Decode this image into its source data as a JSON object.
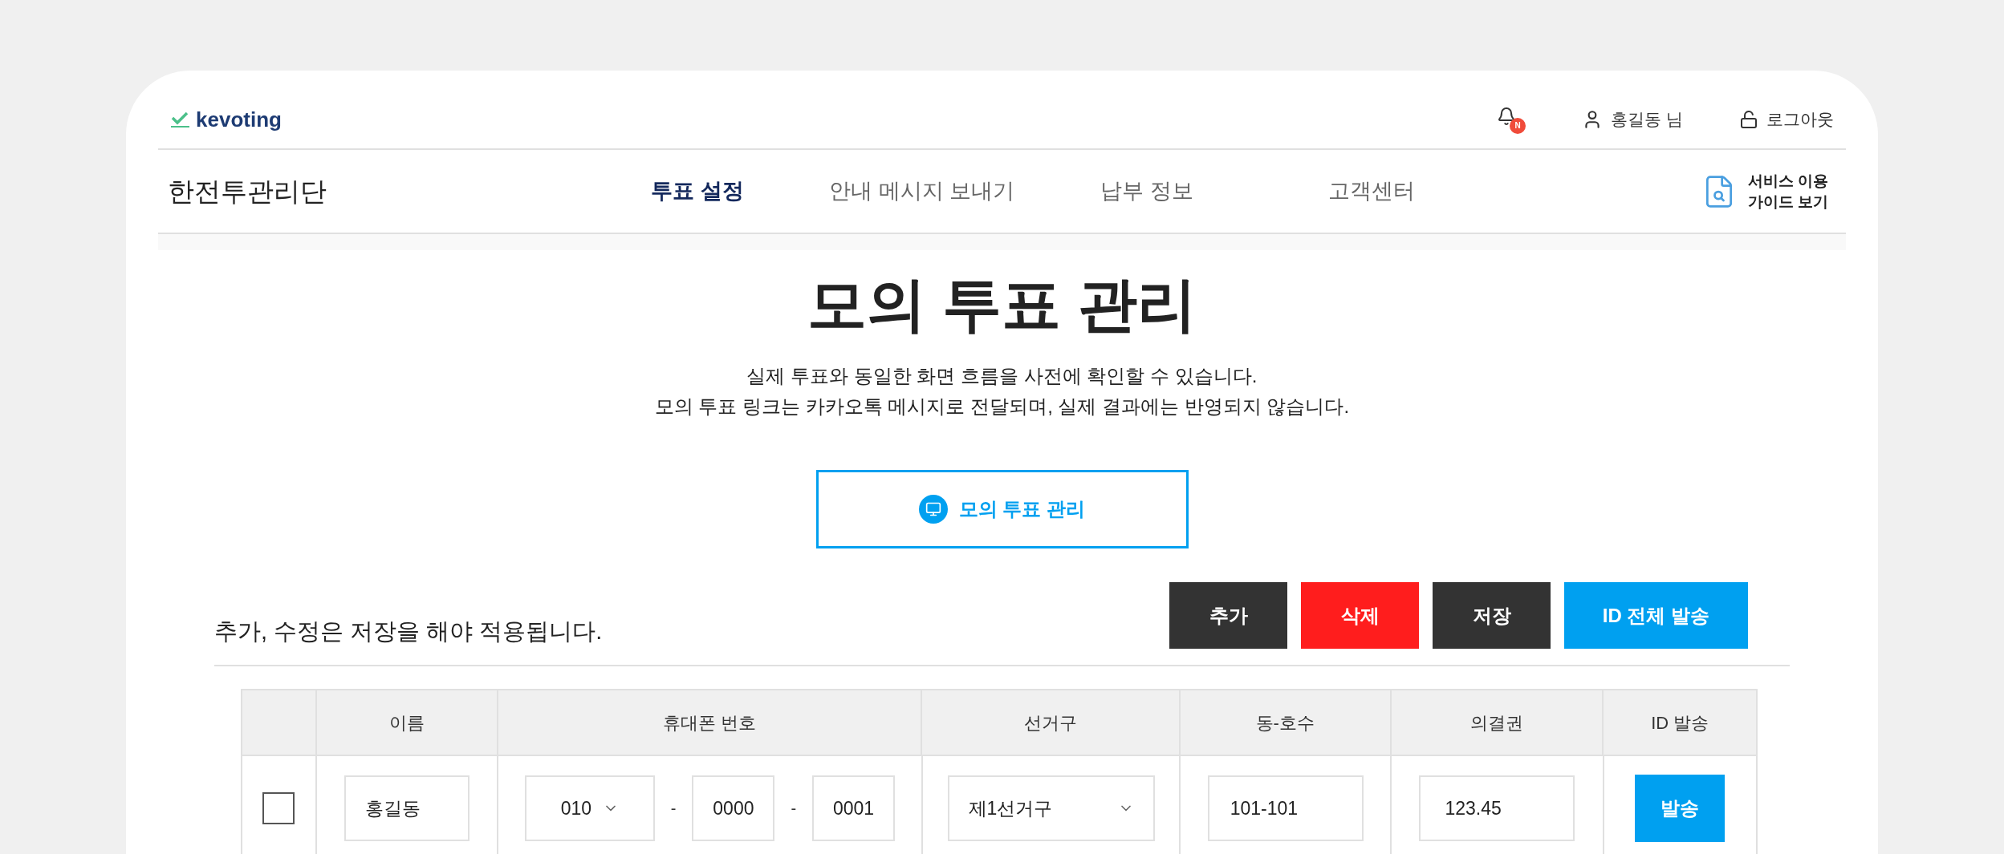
{
  "header": {
    "logo_text": "kevoting",
    "notification_badge": "N",
    "user": "홍길동 님",
    "logout": "로그아웃"
  },
  "nav": {
    "site_title": "한전투관리단",
    "items": [
      {
        "label": "투표 설정",
        "selected": true
      },
      {
        "label": "안내 메시지 보내기",
        "selected": false
      },
      {
        "label": "납부 정보",
        "selected": false
      },
      {
        "label": "고객센터",
        "selected": false
      }
    ],
    "guide_lines": [
      "서비스 이용",
      "가이드 보기"
    ]
  },
  "page": {
    "title": "모의 투표 관리",
    "description": [
      "실제 투표와 동일한 화면 흐름을 사전에 확인할 수 있습니다.",
      "모의 투표 링크는 카카오톡 메시지로 전달되며, 실제 결과에는 반영되지 않습니다."
    ],
    "manage_button": "모의 투표 관리"
  },
  "toolbar": {
    "note": "추가, 수정은 저장을 해야 적용됩니다.",
    "actions": [
      {
        "label": "추가",
        "kind": "dark"
      },
      {
        "label": "삭제",
        "kind": "danger"
      },
      {
        "label": "저장",
        "kind": "dark"
      },
      {
        "label": "ID 전체 발송",
        "kind": "primary"
      }
    ]
  },
  "table": {
    "columns": [
      "이름",
      "휴대폰 번호",
      "선거구",
      "동-호수",
      "의결권",
      "ID 발송"
    ],
    "rows": [
      {
        "checked": false,
        "name": "홍길동",
        "phone_prefix": "010",
        "phone_middle": "0000",
        "phone_last": "0001",
        "phone_separator": "-",
        "district": "제1선거구",
        "unit": "101-101",
        "votes": "123.45",
        "send": "발송"
      }
    ]
  }
}
